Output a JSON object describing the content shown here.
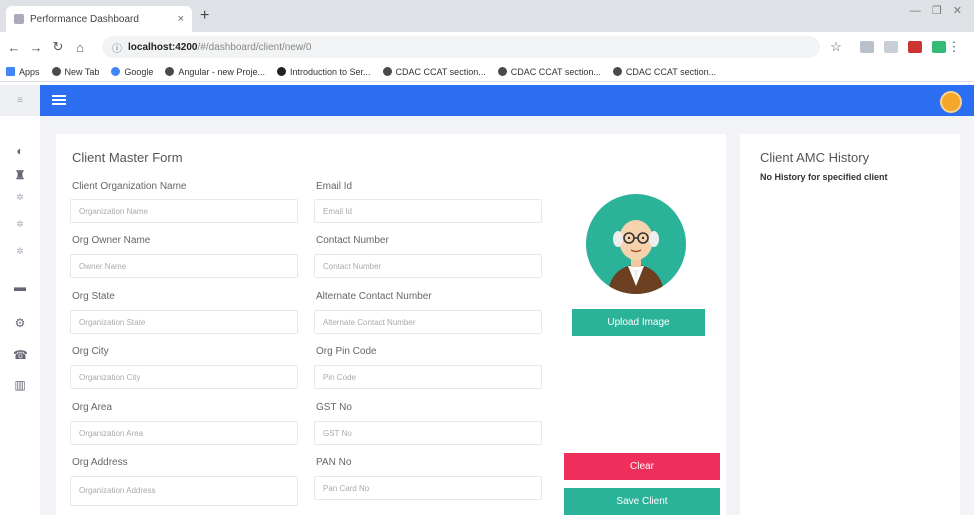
{
  "browser": {
    "tab_title": "Performance Dashboard",
    "tab_close": "×",
    "new_tab": "+",
    "window_controls": "— ❐ ✕",
    "url_host": "localhost:4200",
    "url_path": "/#/dashboard/client/new/0",
    "bookmarks": [
      "Apps",
      "New Tab",
      "Google",
      "Angular - new Proje...",
      "Introduction to Ser...",
      "CDAC CCAT section...",
      "CDAC CCAT section...",
      "CDAC CCAT section..."
    ]
  },
  "colors": {
    "appbar": "#2c6ef2",
    "teal": "#2bb39a",
    "clear": "#ee2f5c",
    "avatar": "#f4a62a"
  },
  "sidenav": {
    "icons": [
      "palette-icon",
      "bank-icon",
      "settings-icon",
      "settings-icon",
      "settings-icon",
      "sofa-icon",
      "motorcycle-icon",
      "phone-icon",
      "analytics-icon"
    ]
  },
  "form": {
    "title": "Client Master Form",
    "fields": {
      "org_name": {
        "label": "Client Organization Name",
        "placeholder": "Organization Name"
      },
      "email": {
        "label": "Email Id",
        "placeholder": "Email Id"
      },
      "owner": {
        "label": "Org Owner Name",
        "placeholder": "Owner Name"
      },
      "contact": {
        "label": "Contact Number",
        "placeholder": "Contact Number"
      },
      "state": {
        "label": "Org State",
        "placeholder": "Organization State"
      },
      "alt_contact": {
        "label": "Alternate Contact Number",
        "placeholder": "Alternate Contact Number"
      },
      "city": {
        "label": "Org City",
        "placeholder": "Organization City"
      },
      "pin": {
        "label": "Org Pin Code",
        "placeholder": "Pin Code"
      },
      "area": {
        "label": "Org Area",
        "placeholder": "Organization Area"
      },
      "gst": {
        "label": "GST No",
        "placeholder": "GST No"
      },
      "address": {
        "label": "Org Address",
        "placeholder": "Organization Address"
      },
      "pan": {
        "label": "PAN No",
        "placeholder": "Pan Card No"
      }
    },
    "upload_label": "Upload Image",
    "clear_label": "Clear",
    "save_label": "Save Client"
  },
  "history": {
    "title": "Client AMC History",
    "empty_text": "No History for specified client"
  }
}
